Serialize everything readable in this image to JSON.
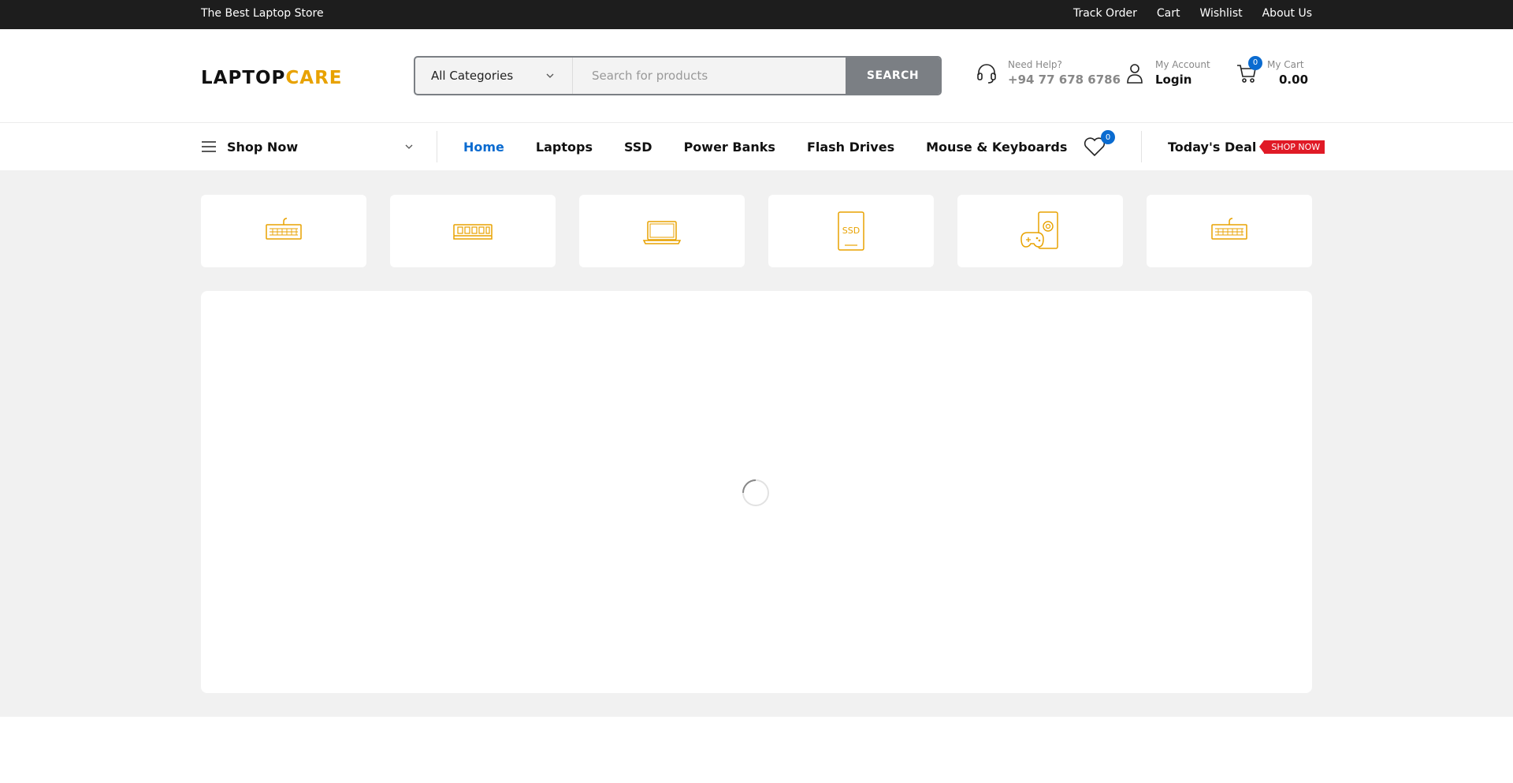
{
  "topbar": {
    "tagline": "The Best Laptop Store",
    "links": [
      "Track Order",
      "Cart",
      "Wishlist",
      "About Us"
    ]
  },
  "header": {
    "logo": {
      "part1": "LAPTOP",
      "part2": "CARE"
    },
    "search": {
      "category": "All Categories",
      "placeholder": "Search for products",
      "button": "SEARCH"
    },
    "help": {
      "label": "Need Help?",
      "phone": "+94 77 678 6786"
    },
    "account": {
      "label": "My Account",
      "action": "Login"
    },
    "cart": {
      "label": "My Cart",
      "total": "0.00",
      "count": "0"
    }
  },
  "nav": {
    "shop_now": "Shop Now",
    "links": [
      {
        "label": "Home",
        "active": true
      },
      {
        "label": "Laptops"
      },
      {
        "label": "SSD"
      },
      {
        "label": "Power Banks"
      },
      {
        "label": "Flash Drives"
      },
      {
        "label": "Mouse & Keyboards"
      }
    ],
    "wishlist_count": "0",
    "deal": {
      "label": "Today's Deal",
      "tag": "SHOP NOW"
    }
  },
  "categories": [
    {
      "icon": "keyboard-icon"
    },
    {
      "icon": "ram-icon"
    },
    {
      "icon": "laptop-icon"
    },
    {
      "icon": "ssd-icon"
    },
    {
      "icon": "gaming-icon"
    },
    {
      "icon": "keyboard-icon"
    }
  ],
  "ssd_icon_text": "SSD",
  "colors": {
    "accent": "#e8a200",
    "primary_blue": "#0a6bd0",
    "deal_red": "#e01a26",
    "topbar_bg": "#1d1d1d",
    "content_bg": "#f1f1f1",
    "search_button": "#7b7f84"
  },
  "main_panel": {
    "state": "loading"
  }
}
